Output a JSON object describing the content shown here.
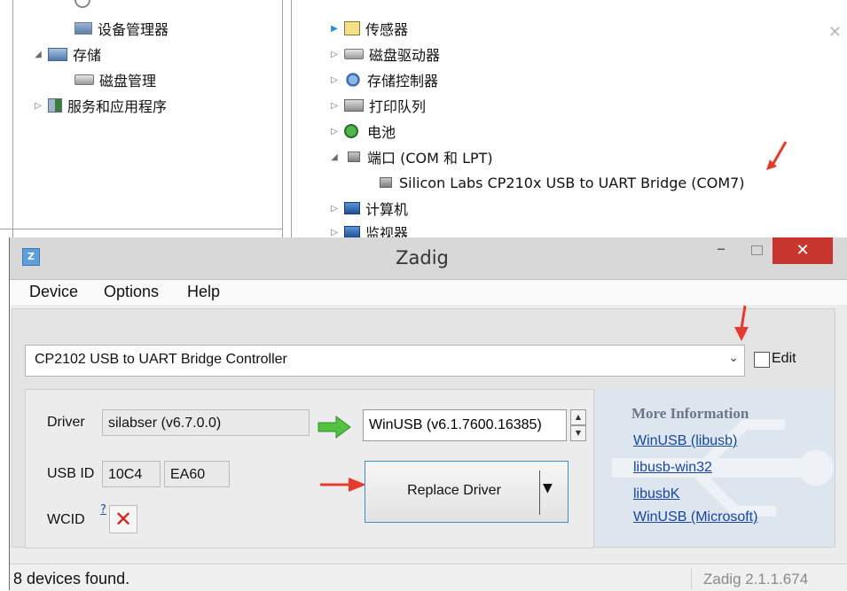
{
  "device_manager": {
    "left_tree": [
      {
        "label": "设备管理器",
        "indent": 2,
        "icon": "device-manager-icon"
      },
      {
        "label": "存储",
        "indent": 1,
        "icon": "storage-icon",
        "expand": "open"
      },
      {
        "label": "磁盘管理",
        "indent": 2,
        "icon": "disk-icon"
      },
      {
        "label": "服务和应用程序",
        "indent": 1,
        "icon": "services-icon",
        "expand": "closed"
      }
    ],
    "right_tree": [
      {
        "label": "传感器",
        "icon": "sensor-icon"
      },
      {
        "label": "磁盘驱动器",
        "icon": "disk-drive-icon"
      },
      {
        "label": "存储控制器",
        "icon": "storage-controller-icon"
      },
      {
        "label": "打印队列",
        "icon": "printer-icon"
      },
      {
        "label": "电池",
        "icon": "battery-icon"
      },
      {
        "label": "端口 (COM 和 LPT)",
        "icon": "port-icon"
      },
      {
        "label": "Silicon Labs CP210x USB to UART Bridge (COM7)",
        "icon": "port-device-icon"
      },
      {
        "label": "计算机",
        "icon": "computer-icon"
      },
      {
        "label": "监视器",
        "icon": "monitor-icon"
      }
    ]
  },
  "zadig": {
    "title": "Zadig",
    "app_icon_glyph": "Z",
    "window_controls": {
      "minimize": "–",
      "close": "✕"
    },
    "menu": [
      "Device",
      "Options",
      "Help"
    ],
    "device_select": {
      "value": "CP2102 USB to UART Bridge Controller",
      "arrow": "⌄"
    },
    "edit_label": "Edit",
    "driver_label": "Driver",
    "current_driver": "silabser (v6.7.0.0)",
    "target_driver": "WinUSB (v6.1.7600.16385)",
    "usb_id_label": "USB ID",
    "usb_vid": "10C4",
    "usb_pid": "EA60",
    "wcid_label": "WCID",
    "wcid_help": "?",
    "wcid_status": "✕",
    "replace_button": "Replace Driver",
    "more_info_title": "More Information",
    "info_links": [
      "WinUSB (libusb)",
      "libusb-win32",
      "libusbK",
      "WinUSB (Microsoft)"
    ],
    "status_left": "8 devices found.",
    "status_right": "Zadig 2.1.1.674"
  },
  "colors": {
    "accent_red": "#e53a2c",
    "close_red": "#c7362e",
    "link_blue": "#1846a3",
    "green_arrow": "#53c241"
  }
}
